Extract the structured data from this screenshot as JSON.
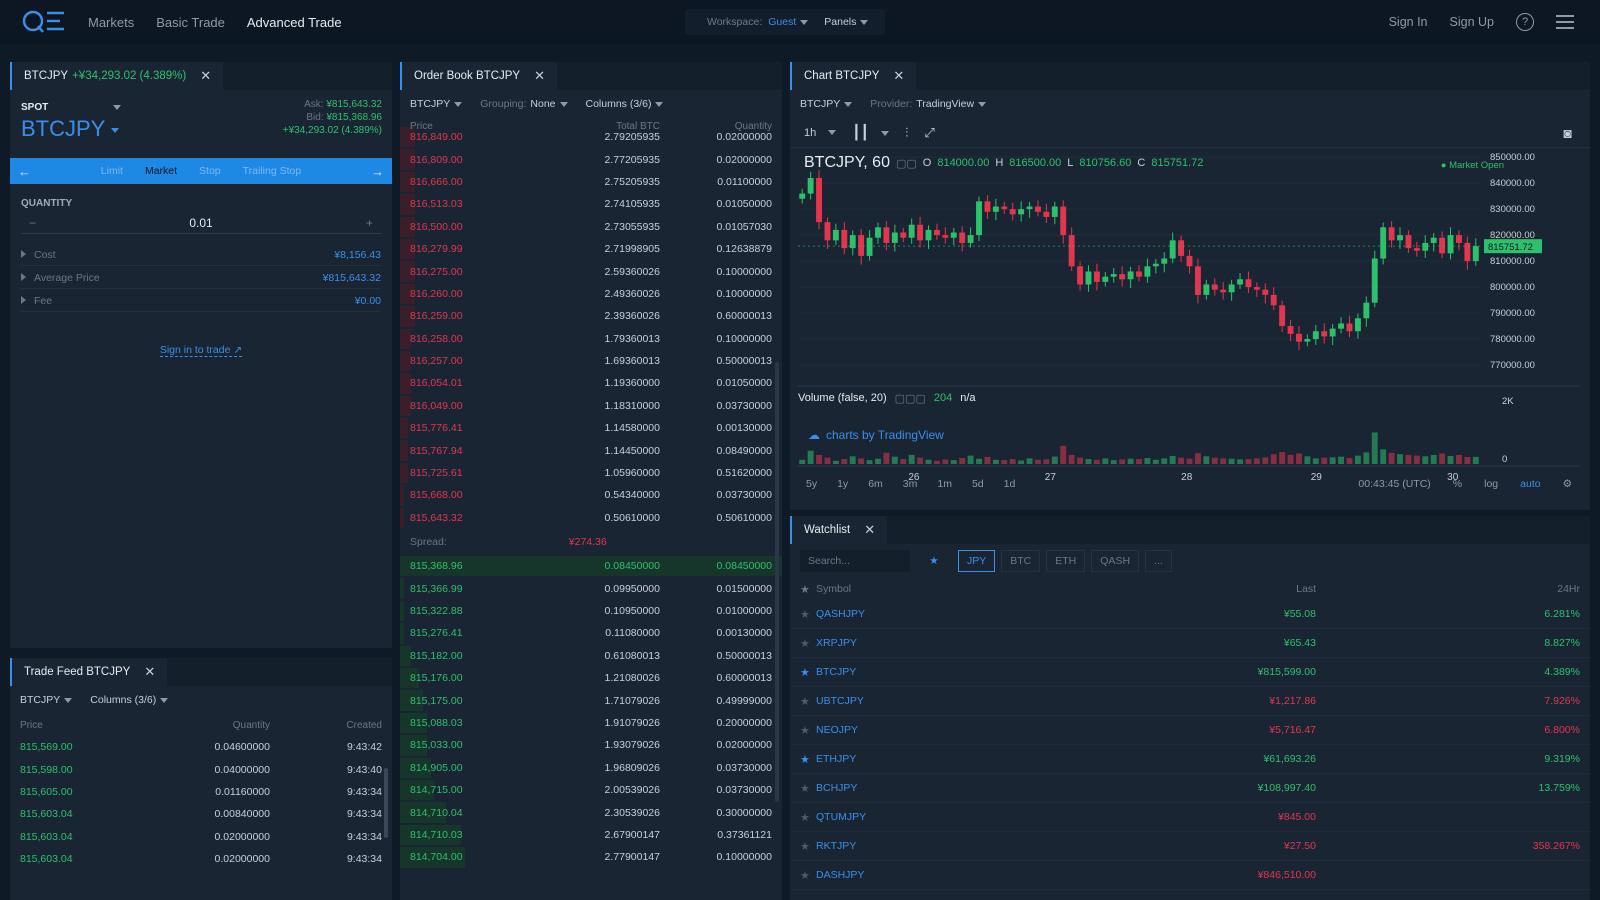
{
  "nav": {
    "items": [
      "Markets",
      "Basic Trade",
      "Advanced Trade"
    ],
    "workspace_label": "Workspace:",
    "workspace_value": "Guest",
    "panels_label": "Panels",
    "sign_in": "Sign In",
    "sign_up": "Sign Up",
    "help": "?"
  },
  "trade": {
    "tab_pair": "BTCJPY",
    "tab_change": "+¥34,293.02 (4.389%)",
    "spot": "SPOT",
    "pair": "BTCJPY",
    "ask_label": "Ask:",
    "ask": "¥815,643.32",
    "bid_label": "Bid:",
    "bid": "¥815,368.96",
    "change": "+¥34,293.02 (4.389%)",
    "order_types": [
      "Limit",
      "Market",
      "Stop",
      "Trailing Stop"
    ],
    "quantity_label": "QUANTITY",
    "quantity_value": "0.01",
    "minus": "−",
    "plus": "+",
    "cost_label": "Cost",
    "cost_value": "¥8,156.43",
    "avg_label": "Average Price",
    "avg_value": "¥815,643.32",
    "fee_label": "Fee",
    "fee_value": "¥0.00",
    "signin": "Sign in to trade ↗"
  },
  "tradefeed": {
    "tab": "Trade Feed BTCJPY",
    "pair": "BTCJPY",
    "columns": "Columns (3/6)",
    "headers": [
      "Price",
      "Quantity",
      "Created"
    ],
    "rows": [
      {
        "price": "815,569.00",
        "qty": "0.04600000",
        "time": "9:43:42"
      },
      {
        "price": "815,598.00",
        "qty": "0.04000000",
        "time": "9:43:40"
      },
      {
        "price": "815,605.00",
        "qty": "0.01160000",
        "time": "9:43:34"
      },
      {
        "price": "815,603.04",
        "qty": "0.00840000",
        "time": "9:43:34"
      },
      {
        "price": "815,603.04",
        "qty": "0.02000000",
        "time": "9:43:34"
      },
      {
        "price": "815,603.04",
        "qty": "0.02000000",
        "time": "9:43:34"
      }
    ]
  },
  "orderbook": {
    "tab": "Order Book BTCJPY",
    "pair": "BTCJPY",
    "grouping_label": "Grouping:",
    "grouping": "None",
    "columns": "Columns (3/6)",
    "headers": [
      "Price",
      "Total BTC",
      "Quantity"
    ],
    "asks": [
      {
        "price": "816,849.00",
        "total": "2.79205935",
        "qty": "0.02000000",
        "depth": 0.04
      },
      {
        "price": "816,809.00",
        "total": "2.77205935",
        "qty": "0.02000000",
        "depth": 0.04
      },
      {
        "price": "816,666.00",
        "total": "2.75205935",
        "qty": "0.01100000",
        "depth": 0.04
      },
      {
        "price": "816,513.03",
        "total": "2.74105935",
        "qty": "0.01050000",
        "depth": 0.04
      },
      {
        "price": "816,500.00",
        "total": "2.73055935",
        "qty": "0.01057030",
        "depth": 0.04
      },
      {
        "price": "816,279.99",
        "total": "2.71998905",
        "qty": "0.12638879",
        "depth": 0.04
      },
      {
        "price": "816,275.00",
        "total": "2.59360026",
        "qty": "0.10000000",
        "depth": 0.04
      },
      {
        "price": "816,260.00",
        "total": "2.49360026",
        "qty": "0.10000000",
        "depth": 0.04
      },
      {
        "price": "816,259.00",
        "total": "2.39360026",
        "qty": "0.60000013",
        "depth": 0.04
      },
      {
        "price": "816,258.00",
        "total": "1.79360013",
        "qty": "0.10000000",
        "depth": 0.03
      },
      {
        "price": "816,257.00",
        "total": "1.69360013",
        "qty": "0.50000013",
        "depth": 0.03
      },
      {
        "price": "816,054.01",
        "total": "1.19360000",
        "qty": "0.01050000",
        "depth": 0.03
      },
      {
        "price": "816,049.00",
        "total": "1.18310000",
        "qty": "0.03730000",
        "depth": 0.03
      },
      {
        "price": "815,776.41",
        "total": "1.14580000",
        "qty": "0.00130000",
        "depth": 0.02
      },
      {
        "price": "815,767.94",
        "total": "1.14450000",
        "qty": "0.08490000",
        "depth": 0.02
      },
      {
        "price": "815,725.61",
        "total": "1.05960000",
        "qty": "0.51620000",
        "depth": 0.02
      },
      {
        "price": "815,668.00",
        "total": "0.54340000",
        "qty": "0.03730000",
        "depth": 0.01
      },
      {
        "price": "815,643.32",
        "total": "0.50610000",
        "qty": "0.50610000",
        "depth": 0.01
      }
    ],
    "spread_label": "Spread:",
    "spread": "¥274.36",
    "bids": [
      {
        "price": "815,368.96",
        "total": "0.08450000",
        "qty": "0.08450000",
        "depth": 1.0
      },
      {
        "price": "815,366.99",
        "total": "0.09950000",
        "qty": "0.01500000",
        "depth": 0.01
      },
      {
        "price": "815,322.88",
        "total": "0.10950000",
        "qty": "0.01000000",
        "depth": 0.01
      },
      {
        "price": "815,276.41",
        "total": "0.11080000",
        "qty": "0.00130000",
        "depth": 0.01
      },
      {
        "price": "815,182.00",
        "total": "0.61080013",
        "qty": "0.50000013",
        "depth": 0.03
      },
      {
        "price": "815,176.00",
        "total": "1.21080026",
        "qty": "0.60000013",
        "depth": 0.05
      },
      {
        "price": "815,175.00",
        "total": "1.71079026",
        "qty": "0.49999000",
        "depth": 0.06
      },
      {
        "price": "815,088.03",
        "total": "1.91079026",
        "qty": "0.20000000",
        "depth": 0.07
      },
      {
        "price": "815,033.00",
        "total": "1.93079026",
        "qty": "0.02000000",
        "depth": 0.07
      },
      {
        "price": "814,905.00",
        "total": "1.96809026",
        "qty": "0.03730000",
        "depth": 0.08
      },
      {
        "price": "814,715.00",
        "total": "2.00539026",
        "qty": "0.03730000",
        "depth": 0.09
      },
      {
        "price": "814,710.04",
        "total": "2.30539026",
        "qty": "0.30000000",
        "depth": 0.12
      },
      {
        "price": "814,710.03",
        "total": "2.67900147",
        "qty": "0.37361121",
        "depth": 0.16
      },
      {
        "price": "814,704.00",
        "total": "2.77900147",
        "qty": "0.10000000",
        "depth": 0.17
      }
    ]
  },
  "chart": {
    "tab": "Chart BTCJPY",
    "pair": "BTCJPY",
    "provider_label": "Provider:",
    "provider": "TradingView",
    "interval": "1h",
    "legend_symbol": "BTCJPY, 60",
    "o_label": "O",
    "o": "814000.00",
    "h_label": "H",
    "h": "816500.00",
    "l_label": "L",
    "l": "810756.60",
    "c_label": "C",
    "c": "815751.72",
    "market_open": "● Market Open",
    "y_ticks": [
      "850000.00",
      "840000.00",
      "830000.00",
      "820000.00",
      "810000.00",
      "800000.00",
      "790000.00",
      "780000.00",
      "770000.00"
    ],
    "last_price_tag": "815751.72",
    "volume_label": "Volume (false, 20)",
    "volume_value": "204",
    "volume_na": "n/a",
    "vol_ticks": [
      "2K",
      "0"
    ],
    "branding": "charts by TradingView",
    "x_ticks": [
      "26",
      "27",
      "28",
      "29",
      "30"
    ],
    "ranges": [
      "5y",
      "1y",
      "6m",
      "3m",
      "1m",
      "5d",
      "1d"
    ],
    "time": "00:43:45 (UTC)",
    "pct": "%",
    "log": "log",
    "auto": "auto"
  },
  "chart_data": {
    "type": "line",
    "title": "BTCJPY, 60",
    "ylim": [
      765000,
      852000
    ],
    "x_ticks": [
      "26",
      "27",
      "28",
      "29",
      "30"
    ],
    "series": [
      {
        "values": [
          836000,
          842000,
          825000,
          818000,
          822000,
          815000,
          820000,
          812000,
          819000,
          823000,
          817000,
          821000,
          819000,
          824000,
          818000,
          822000,
          820000,
          819000,
          821000,
          817000,
          820000,
          833000,
          829000,
          831000,
          830000,
          828000,
          830000,
          831000,
          829000,
          827000,
          831000,
          820000,
          808000,
          801000,
          806000,
          802000,
          804000,
          805000,
          803000,
          806000,
          804000,
          808000,
          809000,
          811000,
          818000,
          812000,
          808000,
          797000,
          801000,
          799000,
          798000,
          801000,
          803000,
          800000,
          799000,
          797000,
          793000,
          785000,
          782000,
          779000,
          780000,
          783000,
          781000,
          784000,
          786000,
          783000,
          788000,
          794000,
          811000,
          823000,
          818000,
          820000,
          815000,
          814000,
          817000,
          819000,
          813000,
          820000,
          817000,
          810000,
          815751
        ]
      },
      {
        "name": "Volume (false, 20)",
        "values": [
          120,
          380,
          260,
          180,
          90,
          140,
          220,
          160,
          110,
          150,
          320,
          210,
          140,
          260,
          180,
          120,
          90,
          130,
          110,
          170,
          240,
          150,
          200,
          120,
          110,
          140,
          100,
          160,
          120,
          130,
          210,
          520,
          260,
          180,
          140,
          120,
          160,
          110,
          130,
          150,
          140,
          170,
          120,
          160,
          230,
          180,
          150,
          310,
          220,
          180,
          160,
          150,
          130,
          140,
          160,
          190,
          280,
          340,
          260,
          300,
          220,
          160,
          180,
          190,
          210,
          170,
          240,
          330,
          900,
          420,
          320,
          280,
          260,
          240,
          220,
          260,
          300,
          230,
          260,
          200,
          204
        ]
      }
    ]
  },
  "watchlist": {
    "tab": "Watchlist",
    "search_placeholder": "Search...",
    "star": "★",
    "filters": [
      "JPY",
      "BTC",
      "ETH",
      "QASH",
      "..."
    ],
    "headers": [
      "Symbol",
      "Last",
      "24Hr"
    ],
    "rows": [
      {
        "sym": "QASHJPY",
        "last": "¥55.08",
        "chg": "6.281%",
        "fav": false,
        "up": true
      },
      {
        "sym": "XRPJPY",
        "last": "¥65.43",
        "chg": "8.827%",
        "fav": false,
        "up": true
      },
      {
        "sym": "BTCJPY",
        "last": "¥815,599.00",
        "chg": "4.389%",
        "fav": true,
        "up": true
      },
      {
        "sym": "UBTCJPY",
        "last": "¥1,217.86",
        "chg": "7.926%",
        "fav": false,
        "up": false
      },
      {
        "sym": "NEOJPY",
        "last": "¥5,716.47",
        "chg": "6.800%",
        "fav": false,
        "up": false
      },
      {
        "sym": "ETHJPY",
        "last": "¥61,693.26",
        "chg": "9.319%",
        "fav": true,
        "up": true
      },
      {
        "sym": "BCHJPY",
        "last": "¥108,997.40",
        "chg": "13.759%",
        "fav": false,
        "up": true
      },
      {
        "sym": "QTUMJPY",
        "last": "¥845.00",
        "chg": "",
        "fav": false,
        "up": false
      },
      {
        "sym": "RKTJPY",
        "last": "¥27.50",
        "chg": "358.267%",
        "fav": false,
        "up": false
      },
      {
        "sym": "DASHJPY",
        "last": "¥846,510.00",
        "chg": "",
        "fav": false,
        "up": false
      }
    ]
  },
  "colors": {
    "up": "#2ec16c",
    "down": "#e2364f",
    "accent": "#3a8fe8"
  }
}
